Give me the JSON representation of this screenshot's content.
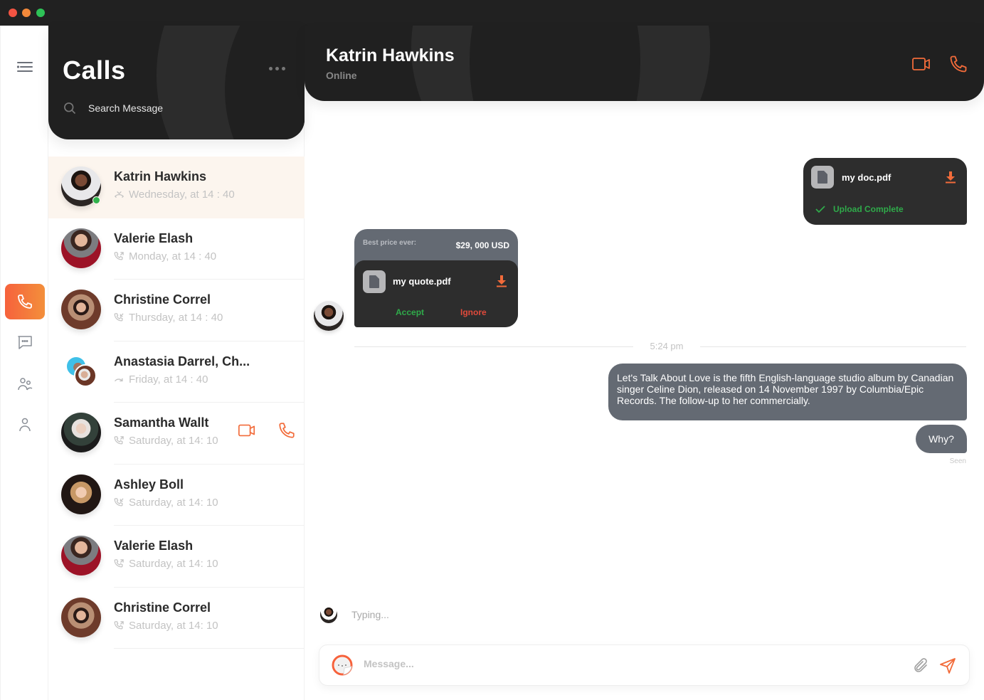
{
  "window": {
    "controls": [
      "close",
      "minimize",
      "maximize"
    ]
  },
  "rail": {
    "items": [
      {
        "icon": "menu-icon",
        "label": "Menu",
        "active": false
      },
      {
        "icon": "phone-icon",
        "label": "Calls",
        "active": true
      },
      {
        "icon": "chat-icon",
        "label": "Messages",
        "active": false
      },
      {
        "icon": "group-icon",
        "label": "Contacts",
        "active": false
      },
      {
        "icon": "user-icon",
        "label": "Profile",
        "active": false
      }
    ]
  },
  "calls": {
    "title": "Calls",
    "search_placeholder": "Search Message",
    "items": [
      {
        "name": "Katrin Hawkins",
        "meta": "Wednesday, at 14 : 40",
        "call_type": "missed",
        "online": true,
        "active": true
      },
      {
        "name": "Valerie Elash",
        "meta": "Monday, at 14 : 40",
        "call_type": "outgoing"
      },
      {
        "name": "Christine Correl",
        "meta": "Thursday, at 14 : 40",
        "call_type": "incoming"
      },
      {
        "name": "Anastasia Darrel, Ch...",
        "meta": "Friday, at 14 : 40",
        "call_type": "forwarded",
        "group": true
      },
      {
        "name": "Samantha Wallt",
        "meta": "Saturday, at 14: 10",
        "call_type": "outgoing",
        "actions": [
          "video-call",
          "voice-call"
        ]
      },
      {
        "name": "Ashley Boll",
        "meta": "Saturday, at 14: 10",
        "call_type": "incoming"
      },
      {
        "name": "Valerie Elash",
        "meta": "Saturday, at 14: 10",
        "call_type": "outgoing"
      },
      {
        "name": "Christine Correl",
        "meta": "Saturday, at 14: 10",
        "call_type": "outgoing"
      }
    ]
  },
  "chat": {
    "contact_name": "Katrin Hawkins",
    "status": "Online",
    "messages": {
      "doc": {
        "file_name": "my doc.pdf",
        "status": "Upload Complete"
      },
      "quote": {
        "label": "Best price ever:",
        "price": "$29, 000 USD",
        "file_name": "my quote.pdf",
        "accept": "Accept",
        "ignore": "Ignore"
      },
      "divider_time": "5:24 pm",
      "long_text": "Let's Talk About Love is the fifth English-language studio album by Canadian singer Celine Dion, released on 14 November 1997 by Columbia/Epic Records. The follow-up to her commercially.",
      "short_text": "Why?",
      "seen": "Seen"
    },
    "typing": "Typing...",
    "composer_placeholder": "Message..."
  },
  "colors": {
    "accent": "#f6623c",
    "accent_end": "#f38f3b",
    "dark": "#202020",
    "bubble": "#646a73",
    "success": "#2faa4a",
    "danger": "#e04a3b",
    "active_row": "#fcf5ee"
  }
}
